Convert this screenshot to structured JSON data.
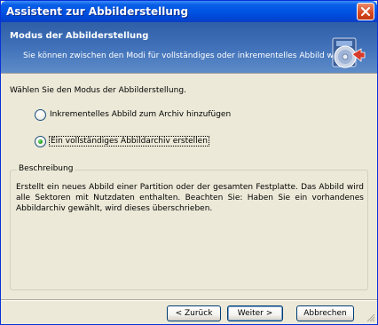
{
  "window": {
    "title": "Assistent zur Abbilderstellung"
  },
  "header": {
    "title": "Modus der Abbilderstellung",
    "subtitle": "Sie können zwischen den Modi für vollständiges oder inkrementelles Abbild wählen.",
    "icon": "disk-image-wizard-icon"
  },
  "main": {
    "prompt": "Wählen Sie den Modus der Abbilderstellung.",
    "options": [
      {
        "label": "Inkrementelles Abbild zum Archiv hinzufügen",
        "selected": false
      },
      {
        "label": "Ein vollständiges Abbildarchiv erstellen",
        "selected": true
      }
    ],
    "description": {
      "legend": "Beschreibung",
      "text": "Erstellt ein neues Abbild einer Partition oder der gesamten Festplatte. Das Abbild wird alle Sektoren mit Nutzdaten enthalten. Beachten Sie: Haben Sie ein vorhandenes Abbildarchiv gewählt, wird dieses überschrieben."
    }
  },
  "buttons": {
    "back": "< Zurück",
    "next": "Weiter >",
    "cancel": "Abbrechen"
  },
  "colors": {
    "title_bar": "#0054e3",
    "header_band": "#3e6fb8",
    "dialog_bg": "#ece9d8",
    "radio_dot": "#21a121"
  }
}
